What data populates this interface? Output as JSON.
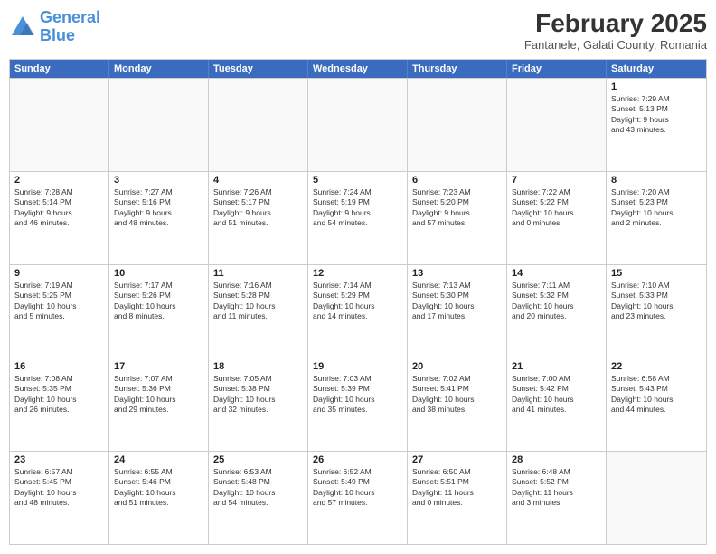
{
  "header": {
    "logo_line1": "General",
    "logo_line2": "Blue",
    "title": "February 2025",
    "subtitle": "Fantanele, Galati County, Romania"
  },
  "days_of_week": [
    "Sunday",
    "Monday",
    "Tuesday",
    "Wednesday",
    "Thursday",
    "Friday",
    "Saturday"
  ],
  "weeks": [
    [
      {
        "day": "",
        "info": ""
      },
      {
        "day": "",
        "info": ""
      },
      {
        "day": "",
        "info": ""
      },
      {
        "day": "",
        "info": ""
      },
      {
        "day": "",
        "info": ""
      },
      {
        "day": "",
        "info": ""
      },
      {
        "day": "1",
        "info": "Sunrise: 7:29 AM\nSunset: 5:13 PM\nDaylight: 9 hours\nand 43 minutes."
      }
    ],
    [
      {
        "day": "2",
        "info": "Sunrise: 7:28 AM\nSunset: 5:14 PM\nDaylight: 9 hours\nand 46 minutes."
      },
      {
        "day": "3",
        "info": "Sunrise: 7:27 AM\nSunset: 5:16 PM\nDaylight: 9 hours\nand 48 minutes."
      },
      {
        "day": "4",
        "info": "Sunrise: 7:26 AM\nSunset: 5:17 PM\nDaylight: 9 hours\nand 51 minutes."
      },
      {
        "day": "5",
        "info": "Sunrise: 7:24 AM\nSunset: 5:19 PM\nDaylight: 9 hours\nand 54 minutes."
      },
      {
        "day": "6",
        "info": "Sunrise: 7:23 AM\nSunset: 5:20 PM\nDaylight: 9 hours\nand 57 minutes."
      },
      {
        "day": "7",
        "info": "Sunrise: 7:22 AM\nSunset: 5:22 PM\nDaylight: 10 hours\nand 0 minutes."
      },
      {
        "day": "8",
        "info": "Sunrise: 7:20 AM\nSunset: 5:23 PM\nDaylight: 10 hours\nand 2 minutes."
      }
    ],
    [
      {
        "day": "9",
        "info": "Sunrise: 7:19 AM\nSunset: 5:25 PM\nDaylight: 10 hours\nand 5 minutes."
      },
      {
        "day": "10",
        "info": "Sunrise: 7:17 AM\nSunset: 5:26 PM\nDaylight: 10 hours\nand 8 minutes."
      },
      {
        "day": "11",
        "info": "Sunrise: 7:16 AM\nSunset: 5:28 PM\nDaylight: 10 hours\nand 11 minutes."
      },
      {
        "day": "12",
        "info": "Sunrise: 7:14 AM\nSunset: 5:29 PM\nDaylight: 10 hours\nand 14 minutes."
      },
      {
        "day": "13",
        "info": "Sunrise: 7:13 AM\nSunset: 5:30 PM\nDaylight: 10 hours\nand 17 minutes."
      },
      {
        "day": "14",
        "info": "Sunrise: 7:11 AM\nSunset: 5:32 PM\nDaylight: 10 hours\nand 20 minutes."
      },
      {
        "day": "15",
        "info": "Sunrise: 7:10 AM\nSunset: 5:33 PM\nDaylight: 10 hours\nand 23 minutes."
      }
    ],
    [
      {
        "day": "16",
        "info": "Sunrise: 7:08 AM\nSunset: 5:35 PM\nDaylight: 10 hours\nand 26 minutes."
      },
      {
        "day": "17",
        "info": "Sunrise: 7:07 AM\nSunset: 5:36 PM\nDaylight: 10 hours\nand 29 minutes."
      },
      {
        "day": "18",
        "info": "Sunrise: 7:05 AM\nSunset: 5:38 PM\nDaylight: 10 hours\nand 32 minutes."
      },
      {
        "day": "19",
        "info": "Sunrise: 7:03 AM\nSunset: 5:39 PM\nDaylight: 10 hours\nand 35 minutes."
      },
      {
        "day": "20",
        "info": "Sunrise: 7:02 AM\nSunset: 5:41 PM\nDaylight: 10 hours\nand 38 minutes."
      },
      {
        "day": "21",
        "info": "Sunrise: 7:00 AM\nSunset: 5:42 PM\nDaylight: 10 hours\nand 41 minutes."
      },
      {
        "day": "22",
        "info": "Sunrise: 6:58 AM\nSunset: 5:43 PM\nDaylight: 10 hours\nand 44 minutes."
      }
    ],
    [
      {
        "day": "23",
        "info": "Sunrise: 6:57 AM\nSunset: 5:45 PM\nDaylight: 10 hours\nand 48 minutes."
      },
      {
        "day": "24",
        "info": "Sunrise: 6:55 AM\nSunset: 5:46 PM\nDaylight: 10 hours\nand 51 minutes."
      },
      {
        "day": "25",
        "info": "Sunrise: 6:53 AM\nSunset: 5:48 PM\nDaylight: 10 hours\nand 54 minutes."
      },
      {
        "day": "26",
        "info": "Sunrise: 6:52 AM\nSunset: 5:49 PM\nDaylight: 10 hours\nand 57 minutes."
      },
      {
        "day": "27",
        "info": "Sunrise: 6:50 AM\nSunset: 5:51 PM\nDaylight: 11 hours\nand 0 minutes."
      },
      {
        "day": "28",
        "info": "Sunrise: 6:48 AM\nSunset: 5:52 PM\nDaylight: 11 hours\nand 3 minutes."
      },
      {
        "day": "",
        "info": ""
      }
    ]
  ]
}
